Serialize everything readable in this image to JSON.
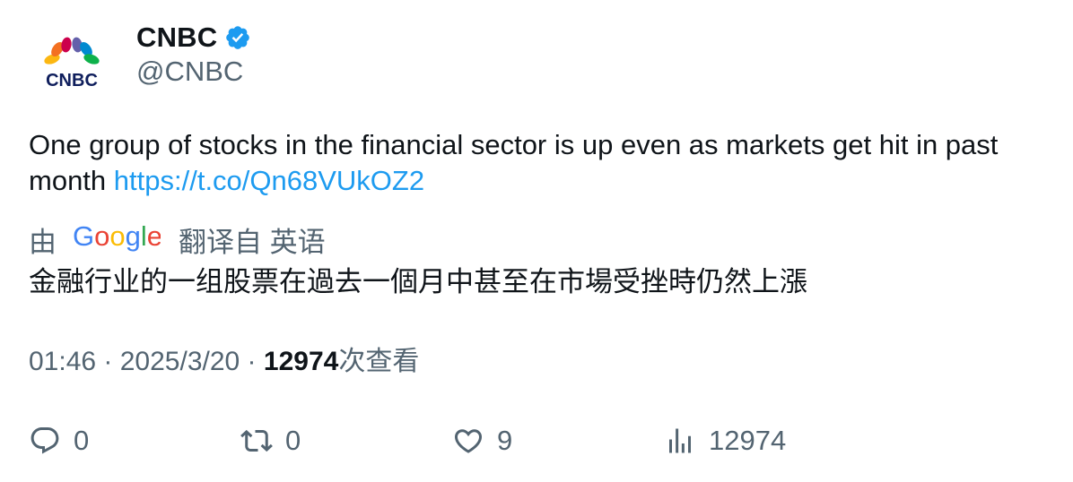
{
  "author": {
    "display_name": "CNBC",
    "handle": "@CNBC",
    "verified": true,
    "avatar_logo_text": "CNBC"
  },
  "tweet": {
    "text_prefix": "One group of stocks in the financial sector is up even as markets get hit in past month ",
    "link_text": "https://t.co/Qn68VUkOZ2"
  },
  "translation": {
    "prefix": "由",
    "provider": "Google",
    "source_lang": "翻译自 英语",
    "text": "金融行业的一组股票在過去一個月中甚至在市場受挫時仍然上漲"
  },
  "meta": {
    "time": "01:46",
    "separator": " · ",
    "date": "2025/3/20",
    "views_count": "12974",
    "views_label": "次查看"
  },
  "actions": {
    "reply_count": "0",
    "retweet_count": "0",
    "like_count": "9",
    "views_count": "12974"
  },
  "colors": {
    "text_primary": "#0f1419",
    "text_secondary": "#536471",
    "link": "#1d9bf0",
    "verified": "#1d9bf0",
    "cnbc_navy": "#0f1e5c"
  },
  "icons": {
    "reply": "reply-bubble-icon",
    "retweet": "retweet-icon",
    "like": "heart-icon",
    "views": "bar-chart-icon",
    "verified": "verified-badge-icon",
    "google": "google-logo"
  }
}
